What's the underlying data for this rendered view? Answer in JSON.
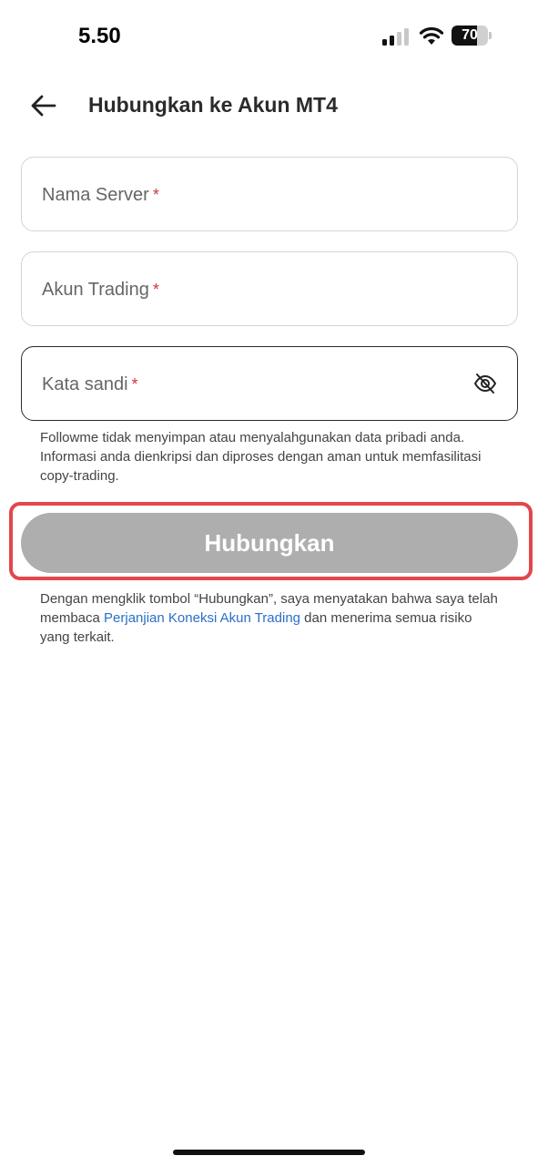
{
  "status_bar": {
    "time": "5.50",
    "battery_level": "70"
  },
  "header": {
    "title": "Hubungkan ke Akun MT4"
  },
  "form": {
    "server": {
      "label": "Nama Server",
      "required_mark": "*"
    },
    "account": {
      "label": "Akun Trading",
      "required_mark": "*"
    },
    "password": {
      "label": "Kata sandi",
      "required_mark": "*"
    },
    "privacy_note": "Followme tidak menyimpan atau menyalahgunakan data pribadi anda. Informasi anda dienkripsi dan diproses dengan aman untuk memfasilitasi copy-trading."
  },
  "connect_button": {
    "label": "Hubungkan"
  },
  "terms": {
    "prefix": "Dengan mengklik tombol “Hubungkan”, saya menyatakan bahwa saya telah membaca ",
    "link": "Perjanjian Koneksi Akun Trading",
    "suffix": " dan menerima semua risiko yang terkait."
  },
  "colors": {
    "highlight_border": "#e3464c",
    "button_disabled": "#aeaeae",
    "link": "#2a6fc9",
    "required": "#d0363f"
  },
  "icons": {
    "back": "arrow-left-icon",
    "password_toggle": "eye-off-icon"
  }
}
